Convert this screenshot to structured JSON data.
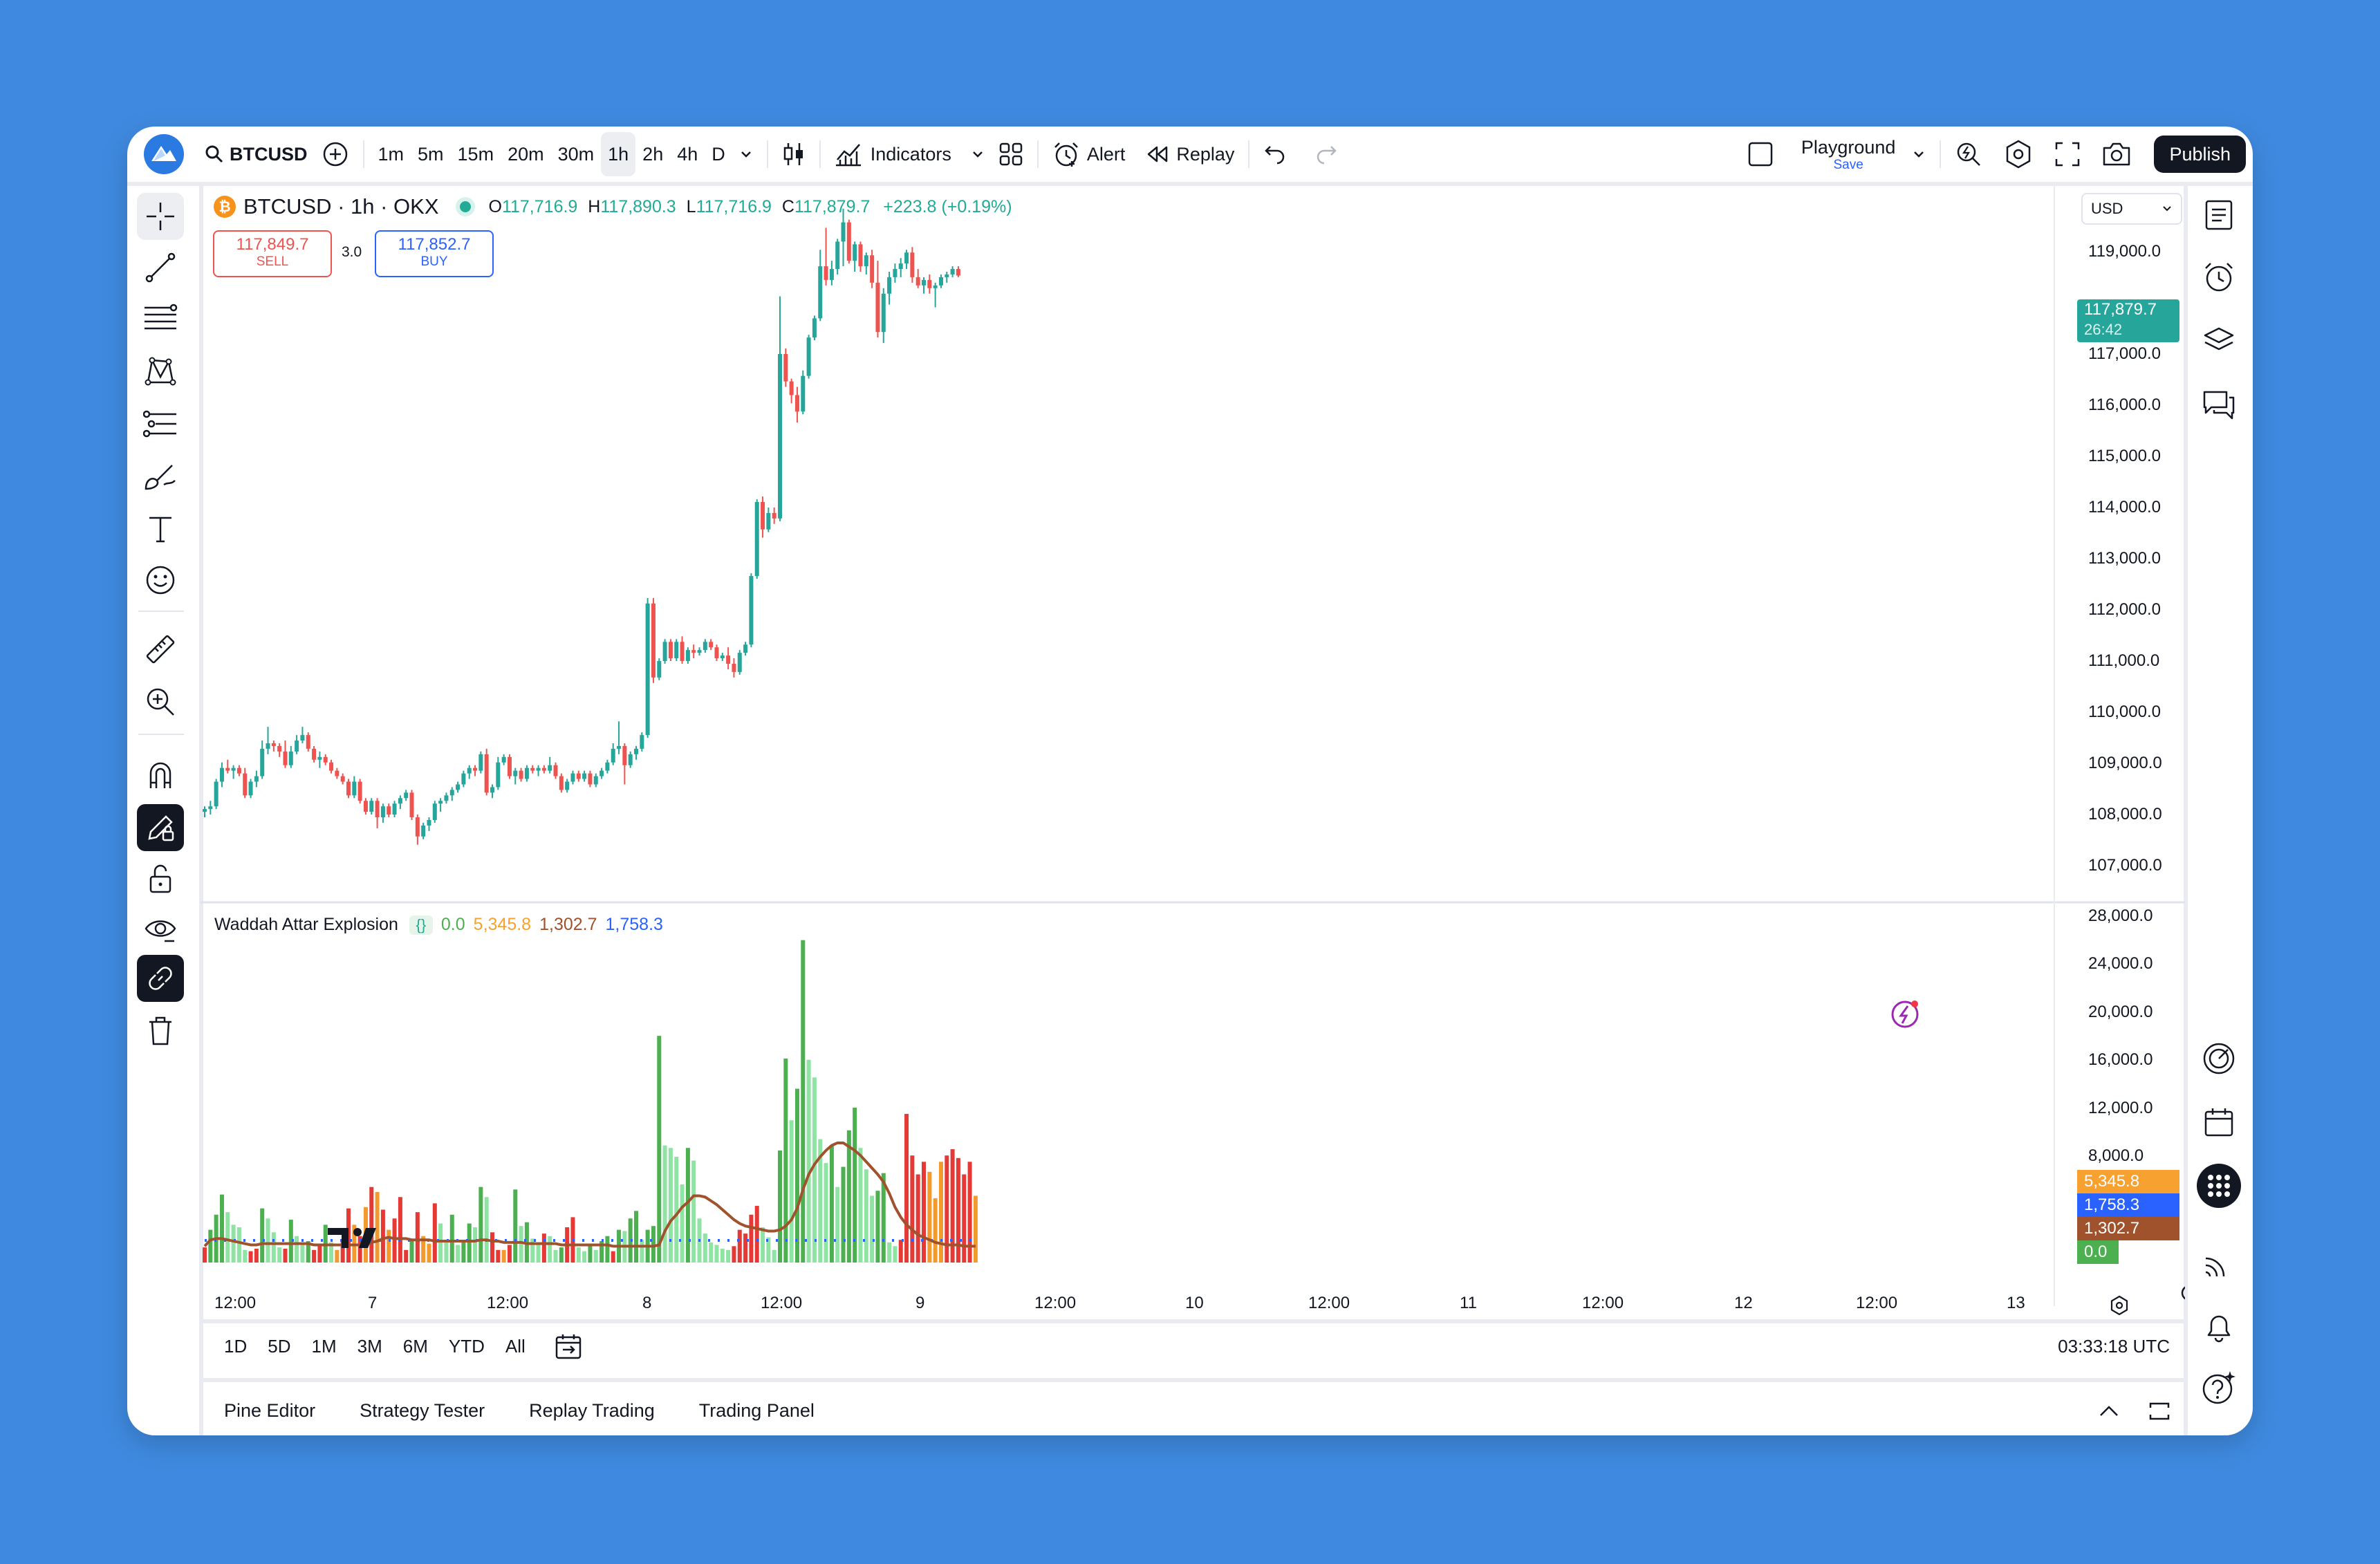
{
  "toolbar": {
    "symbol": "BTCUSD",
    "intervals": [
      "1m",
      "5m",
      "15m",
      "20m",
      "30m",
      "1h",
      "2h",
      "4h",
      "D"
    ],
    "active_interval": "1h",
    "indicators_label": "Indicators",
    "alert_label": "Alert",
    "replay_label": "Replay",
    "layout_name": "Playground",
    "layout_sub": "Save",
    "publish_label": "Publish"
  },
  "legend": {
    "title": "BTCUSD · 1h · OKX",
    "o_label": "O",
    "o_value": "117,716.9",
    "h_label": "H",
    "h_value": "117,890.3",
    "l_label": "L",
    "l_value": "117,716.9",
    "c_label": "C",
    "c_value": "117,879.7",
    "change": "+223.8 (+0.19%)",
    "sell_price": "117,849.7",
    "sell_label": "SELL",
    "spread": "3.0",
    "buy_price": "117,852.7",
    "buy_label": "BUY"
  },
  "currency": "USD",
  "price_axis": [
    "119,000.0",
    "117,000.0",
    "116,000.0",
    "115,000.0",
    "114,000.0",
    "113,000.0",
    "112,000.0",
    "111,000.0",
    "110,000.0",
    "109,000.0",
    "108,000.0",
    "107,000.0"
  ],
  "last_price_tag": {
    "price": "117,879.7",
    "countdown": "26:42"
  },
  "indicator": {
    "name": "Waddah Attar Explosion",
    "v1": "0.0",
    "v2": "5,345.8",
    "v3": "1,302.7",
    "v4": "1,758.3"
  },
  "indicator_axis": [
    "28,000.0",
    "24,000.0",
    "20,000.0",
    "16,000.0",
    "12,000.0",
    "8,000.0"
  ],
  "indicator_tags": [
    "5,345.8",
    "1,758.3",
    "1,302.7",
    "0.0"
  ],
  "time_axis": [
    "12:00",
    "7",
    "12:00",
    "8",
    "12:00",
    "9",
    "12:00",
    "10",
    "12:00",
    "11",
    "12:00",
    "12",
    "12:00",
    "13"
  ],
  "ranges": [
    "1D",
    "5D",
    "1M",
    "3M",
    "6M",
    "YTD",
    "All"
  ],
  "clock": "03:33:18 UTC",
  "bottom_tabs": [
    "Pine Editor",
    "Strategy Tester",
    "Replay Trading",
    "Trading Panel"
  ],
  "colors": {
    "up": "#26a69a",
    "down": "#ef5350",
    "accent": "#2962ff",
    "bg": "#3f8ae0"
  },
  "chart_data": {
    "type": "candlestick",
    "price_ylim": [
      106500,
      119400
    ],
    "candles": [
      [
        108100,
        108200,
        108000,
        108150
      ],
      [
        108150,
        108300,
        108050,
        108200
      ],
      [
        108200,
        108700,
        108150,
        108650
      ],
      [
        108650,
        109000,
        108550,
        108900
      ],
      [
        108900,
        109050,
        108800,
        108850
      ],
      [
        108850,
        108950,
        108700,
        108900
      ],
      [
        108900,
        108950,
        108750,
        108800
      ],
      [
        108800,
        108900,
        108350,
        108400
      ],
      [
        108400,
        108700,
        108350,
        108650
      ],
      [
        108650,
        108850,
        108550,
        108750
      ],
      [
        108750,
        109400,
        108700,
        109250
      ],
      [
        109250,
        109650,
        109150,
        109350
      ],
      [
        109350,
        109400,
        109200,
        109300
      ],
      [
        109300,
        109350,
        109100,
        109200
      ],
      [
        109200,
        109400,
        108900,
        108950
      ],
      [
        108950,
        109300,
        108900,
        109200
      ],
      [
        109200,
        109500,
        109150,
        109400
      ],
      [
        109400,
        109650,
        109350,
        109500
      ],
      [
        109500,
        109550,
        109200,
        109250
      ],
      [
        109250,
        109300,
        109000,
        109050
      ],
      [
        109050,
        109200,
        108900,
        109100
      ],
      [
        109100,
        109150,
        108950,
        109000
      ],
      [
        109000,
        109050,
        108800,
        108850
      ],
      [
        108850,
        108900,
        108700,
        108750
      ],
      [
        108750,
        108800,
        108600,
        108650
      ],
      [
        108650,
        108700,
        108350,
        108400
      ],
      [
        108400,
        108750,
        108350,
        108650
      ],
      [
        108650,
        108700,
        108250,
        108300
      ],
      [
        108300,
        108350,
        108050,
        108100
      ],
      [
        108100,
        108350,
        108050,
        108300
      ],
      [
        108300,
        108350,
        107800,
        108000
      ],
      [
        108000,
        108250,
        107900,
        108200
      ],
      [
        108200,
        108250,
        108000,
        108050
      ],
      [
        108050,
        108300,
        108000,
        108250
      ],
      [
        108250,
        108400,
        108150,
        108350
      ],
      [
        108350,
        108500,
        108300,
        108450
      ],
      [
        108450,
        108500,
        107950,
        108000
      ],
      [
        108000,
        108050,
        107500,
        107650
      ],
      [
        107650,
        107900,
        107600,
        107850
      ],
      [
        107850,
        108000,
        107750,
        107950
      ],
      [
        107950,
        108300,
        107900,
        108250
      ],
      [
        108250,
        108350,
        108100,
        108300
      ],
      [
        108300,
        108450,
        108250,
        108400
      ],
      [
        108400,
        108550,
        108300,
        108500
      ],
      [
        108500,
        108650,
        108450,
        108600
      ],
      [
        108600,
        108850,
        108550,
        108800
      ],
      [
        108800,
        108950,
        108700,
        108900
      ],
      [
        108900,
        108950,
        108750,
        108850
      ],
      [
        108850,
        109200,
        108800,
        109150
      ],
      [
        109150,
        109250,
        108400,
        108450
      ],
      [
        108450,
        108600,
        108350,
        108550
      ],
      [
        108550,
        109100,
        108500,
        109000
      ],
      [
        109000,
        109150,
        108950,
        109100
      ],
      [
        109100,
        109150,
        108700,
        108750
      ],
      [
        108750,
        108900,
        108600,
        108850
      ],
      [
        108850,
        108900,
        108650,
        108700
      ],
      [
        108700,
        108950,
        108650,
        108900
      ],
      [
        108900,
        108950,
        108800,
        108850
      ],
      [
        108850,
        108950,
        108750,
        108900
      ],
      [
        108900,
        108950,
        108800,
        108850
      ],
      [
        108850,
        109100,
        108800,
        108950
      ],
      [
        108950,
        109000,
        108700,
        108750
      ],
      [
        108750,
        108800,
        108450,
        108500
      ],
      [
        108500,
        108700,
        108450,
        108650
      ],
      [
        108650,
        108850,
        108600,
        108800
      ],
      [
        108800,
        108850,
        108650,
        108700
      ],
      [
        108700,
        108850,
        108650,
        108800
      ],
      [
        108800,
        108850,
        108550,
        108600
      ],
      [
        108600,
        108800,
        108550,
        108750
      ],
      [
        108750,
        108900,
        108700,
        108850
      ],
      [
        108850,
        109050,
        108800,
        109000
      ],
      [
        109000,
        109350,
        108950,
        109250
      ],
      [
        109250,
        109750,
        109150,
        109300
      ],
      [
        109300,
        109350,
        108600,
        108950
      ],
      [
        108950,
        109200,
        108900,
        109150
      ],
      [
        109150,
        109300,
        109050,
        109250
      ],
      [
        109250,
        109550,
        109200,
        109500
      ],
      [
        109500,
        112000,
        109450,
        111900
      ],
      [
        111900,
        112000,
        110450,
        110550
      ],
      [
        110550,
        110900,
        110500,
        110850
      ],
      [
        110850,
        111250,
        110800,
        111200
      ],
      [
        111200,
        111250,
        110850,
        110900
      ],
      [
        110900,
        111250,
        110850,
        111200
      ],
      [
        111200,
        111300,
        110800,
        110850
      ],
      [
        110850,
        111100,
        110800,
        111050
      ],
      [
        111050,
        111150,
        110900,
        111000
      ],
      [
        111000,
        111100,
        110950,
        111050
      ],
      [
        111050,
        111250,
        111000,
        111200
      ],
      [
        111200,
        111250,
        111050,
        111100
      ],
      [
        111100,
        111150,
        110850,
        110900
      ],
      [
        110900,
        111000,
        110850,
        110950
      ],
      [
        110950,
        111100,
        110700,
        110800
      ],
      [
        110800,
        110900,
        110550,
        110650
      ],
      [
        110650,
        111050,
        110600,
        111000
      ],
      [
        111000,
        111200,
        110950,
        111150
      ],
      [
        111150,
        112450,
        111100,
        112400
      ],
      [
        112400,
        113800,
        112350,
        113750
      ],
      [
        113750,
        113850,
        113100,
        113250
      ],
      [
        113250,
        113650,
        113200,
        113550
      ],
      [
        113550,
        113650,
        113350,
        113450
      ],
      [
        113450,
        117500,
        113400,
        116450
      ],
      [
        116450,
        116550,
        115850,
        115950
      ],
      [
        115950,
        116000,
        115550,
        115700
      ],
      [
        115700,
        115850,
        115200,
        115400
      ],
      [
        115400,
        116150,
        115350,
        116050
      ],
      [
        116050,
        116800,
        116000,
        116750
      ],
      [
        116750,
        117150,
        116700,
        117100
      ],
      [
        117100,
        118350,
        117050,
        118050
      ],
      [
        118050,
        118750,
        117700,
        117800
      ],
      [
        117800,
        118150,
        117700,
        118000
      ],
      [
        118000,
        118550,
        117900,
        118500
      ],
      [
        118500,
        119100,
        118050,
        118850
      ],
      [
        118850,
        118900,
        118100,
        118150
      ],
      [
        118150,
        118500,
        117950,
        118450
      ],
      [
        118450,
        118500,
        117950,
        118050
      ],
      [
        118050,
        118300,
        117900,
        118250
      ],
      [
        118250,
        118350,
        117650,
        117750
      ],
      [
        117750,
        118150,
        116750,
        116850
      ],
      [
        116850,
        117650,
        116650,
        117550
      ],
      [
        117550,
        117950,
        117350,
        117850
      ],
      [
        117850,
        118100,
        117750,
        118000
      ],
      [
        118000,
        118200,
        117850,
        118100
      ],
      [
        118100,
        118350,
        118000,
        118300
      ],
      [
        118300,
        118400,
        117750,
        117850
      ],
      [
        117850,
        118000,
        117650,
        117700
      ],
      [
        117700,
        117850,
        117550,
        117800
      ],
      [
        117800,
        117900,
        117550,
        117650
      ],
      [
        117650,
        117750,
        117300,
        117700
      ],
      [
        117700,
        117900,
        117650,
        117850
      ],
      [
        117850,
        117950,
        117750,
        117900
      ],
      [
        117900,
        118050,
        117850,
        118000
      ],
      [
        118000,
        118050,
        117850,
        117879.7
      ]
    ],
    "indicator_ylim": [
      0,
      28000
    ],
    "indicator_bars": [
      1200,
      2600,
      3800,
      5400,
      4000,
      3000,
      2800,
      1000,
      900,
      1100,
      4300,
      3500,
      2400,
      1200,
      1100,
      3400,
      2100,
      1400,
      1700,
      1000,
      1500,
      3000,
      1600,
      1000,
      1800,
      4300,
      3000,
      2100,
      4400,
      6000,
      5600,
      4200,
      2600,
      3500,
      5200,
      1000,
      1800,
      4000,
      2100,
      1500,
      4700,
      3100,
      1800,
      3800,
      1400,
      1700,
      3100,
      2800,
      6000,
      5200,
      2400,
      1000,
      1000,
      1400,
      5800,
      2900,
      3200,
      1900,
      1400,
      2300,
      2100,
      1000,
      1200,
      2800,
      3600,
      1200,
      900,
      1500,
      1000,
      1700,
      2100,
      900,
      2600,
      2500,
      3500,
      4100,
      1800,
      2600,
      2900,
      18000,
      9300,
      9100,
      8400,
      6200,
      9100,
      8100,
      3500,
      2300,
      1600,
      1400,
      1100,
      1000,
      1300,
      2600,
      2300,
      3800,
      4500,
      2800,
      2000,
      1000,
      8900,
      16200,
      11300,
      13800,
      25600,
      16100,
      14700,
      9800,
      7900,
      9300,
      6000,
      7600,
      10500,
      12300,
      9100,
      7400,
      5300,
      5700,
      7100,
      1600,
      1300,
      1800,
      11800,
      8500,
      7000,
      8000,
      7200,
      5100,
      8000,
      8500,
      9000,
      8300,
      7000,
      8000,
      5300
    ],
    "indicator_bar_colors": [
      "r",
      "g",
      "g",
      "g",
      "g",
      "g",
      "g",
      "g",
      "r",
      "r",
      "g",
      "g",
      "g",
      "g",
      "r",
      "g",
      "g",
      "g",
      "g",
      "r",
      "r",
      "g",
      "g",
      "o",
      "r",
      "r",
      "o",
      "r",
      "o",
      "r",
      "o",
      "r",
      "o",
      "r",
      "r",
      "r",
      "g",
      "r",
      "o",
      "o",
      "r",
      "g",
      "g",
      "g",
      "g",
      "g",
      "g",
      "g",
      "g",
      "g",
      "r",
      "r",
      "o",
      "r",
      "g",
      "g",
      "g",
      "g",
      "g",
      "r",
      "g",
      "g",
      "g",
      "r",
      "r",
      "g",
      "g",
      "g",
      "g",
      "g",
      "g",
      "r",
      "g",
      "g",
      "g",
      "g",
      "g",
      "g",
      "g",
      "g",
      "g",
      "g",
      "g",
      "g",
      "g",
      "g",
      "g",
      "g",
      "g",
      "g",
      "g",
      "g",
      "r",
      "r",
      "r",
      "r",
      "r",
      "g",
      "g",
      "g",
      "g",
      "g",
      "g",
      "g",
      "g",
      "g",
      "g",
      "g",
      "g",
      "g",
      "g",
      "g",
      "g",
      "g",
      "g",
      "g",
      "g",
      "g",
      "g",
      "g",
      "g",
      "r",
      "r",
      "r",
      "r",
      "r",
      "o",
      "o",
      "o",
      "r",
      "r",
      "r",
      "r",
      "r",
      "o",
      "r",
      "o"
    ],
    "explosion_line": [
      1300,
      1800,
      1900,
      1900,
      1800,
      1700,
      1600,
      1500,
      1400,
      1400,
      1500,
      1500,
      1500,
      1500,
      1500,
      1500,
      1500,
      1500,
      1500,
      1400,
      1400,
      1400,
      1400,
      1400,
      1400,
      1400,
      1400,
      1400,
      1500,
      1600,
      1700,
      1900,
      2000,
      1900,
      1900,
      1900,
      1800,
      1800,
      1800,
      1800,
      1700,
      1700,
      1700,
      1700,
      1700,
      1700,
      1700,
      1700,
      1800,
      1800,
      1700,
      1700,
      1600,
      1600,
      1600,
      1600,
      1500,
      1500,
      1500,
      1500,
      1500,
      1500,
      1400,
      1400,
      1400,
      1400,
      1400,
      1400,
      1400,
      1400,
      1400,
      1300,
      1300,
      1300,
      1300,
      1300,
      1300,
      1300,
      1300,
      1400,
      2500,
      3300,
      3800,
      4400,
      4800,
      5300,
      5300,
      5200,
      4900,
      4600,
      4200,
      3800,
      3400,
      3100,
      2900,
      2800,
      2700,
      2600,
      2500,
      2500,
      2600,
      2900,
      3400,
      4300,
      5800,
      7000,
      7800,
      8400,
      8900,
      9300,
      9500,
      9500,
      9200,
      8900,
      8500,
      8000,
      7500,
      7000,
      6400,
      5500,
      4400,
      3600,
      3000,
      2600,
      2200,
      2000,
      1800,
      1600,
      1500,
      1400,
      1400,
      1400,
      1300,
      1300,
      1300
    ]
  }
}
